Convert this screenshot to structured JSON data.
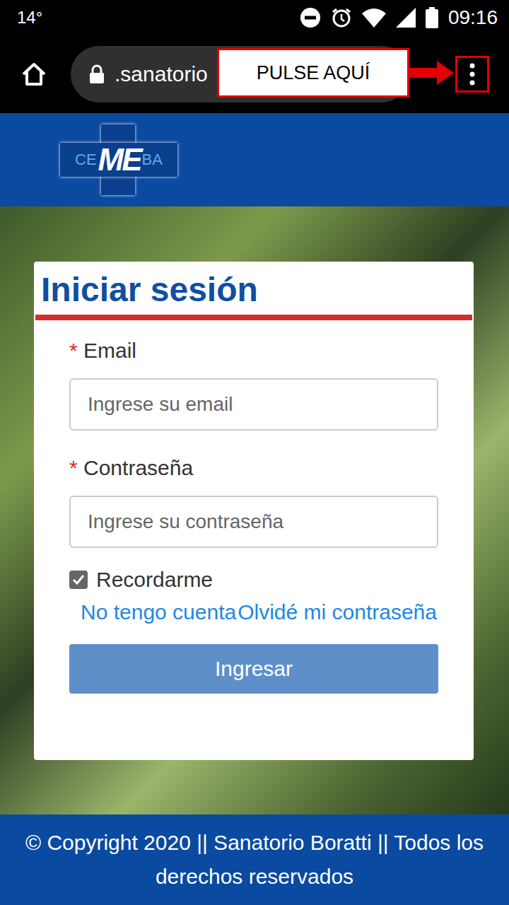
{
  "status_bar": {
    "temperature": "14°",
    "time": "09:16"
  },
  "browser": {
    "url": ".sanatorio",
    "callout": "PULSE AQUÍ"
  },
  "logo": {
    "left": "CE",
    "middle": "ME",
    "right": "BA"
  },
  "login": {
    "title": "Iniciar sesión",
    "fields": [
      {
        "label": "Email",
        "required_mark": "*",
        "placeholder": "Ingrese su email",
        "kind": "email"
      },
      {
        "label": "Contraseña",
        "required_mark": "*",
        "placeholder": "Ingrese su contraseña",
        "kind": "password"
      }
    ],
    "remember": {
      "label": "Recordarme",
      "checked": true
    },
    "links": [
      "No tengo cuenta",
      "Olvidé mi contraseña"
    ],
    "submit": "Ingresar"
  },
  "footer": "© Copyright 2020 || Sanatorio Boratti || Todos los derechos reservados"
}
